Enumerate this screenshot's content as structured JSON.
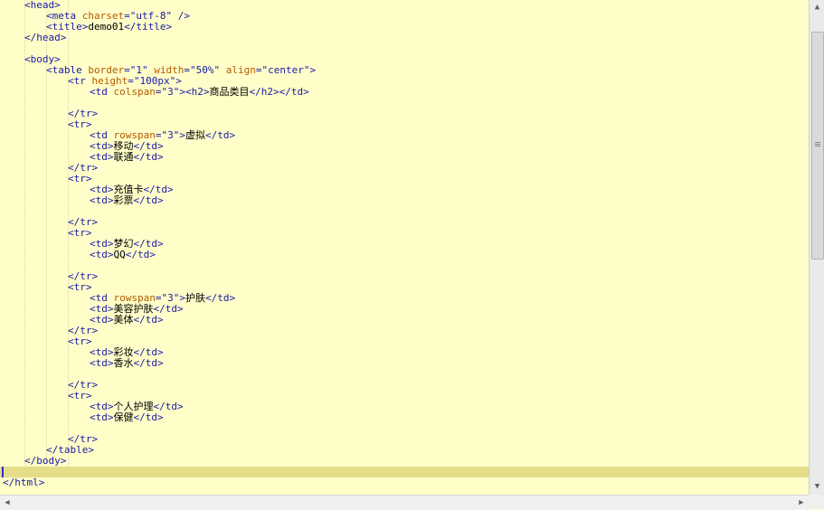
{
  "editor": {
    "lines": [
      [
        {
          "t": "<head>",
          "c": "tag"
        }
      ],
      [
        {
          "t": "<meta ",
          "c": "tag"
        },
        {
          "t": "charset",
          "c": "attr"
        },
        {
          "t": "=\"utf-8\" />",
          "c": "val"
        }
      ],
      [
        {
          "t": "<title>",
          "c": "tag"
        },
        {
          "t": "demo01",
          "c": "text"
        },
        {
          "t": "</title>",
          "c": "tag"
        }
      ],
      [
        {
          "t": "</head>",
          "c": "tag"
        }
      ],
      [],
      [
        {
          "t": "<body>",
          "c": "tag"
        }
      ],
      [
        {
          "t": "<table ",
          "c": "tag"
        },
        {
          "t": "border",
          "c": "attr"
        },
        {
          "t": "=\"1\" ",
          "c": "val"
        },
        {
          "t": "width",
          "c": "attr"
        },
        {
          "t": "=\"50%\" ",
          "c": "val"
        },
        {
          "t": "align",
          "c": "attr"
        },
        {
          "t": "=\"center\">",
          "c": "val"
        }
      ],
      [
        {
          "t": "<tr ",
          "c": "tag"
        },
        {
          "t": "height",
          "c": "attr"
        },
        {
          "t": "=\"100px\">",
          "c": "val"
        }
      ],
      [
        {
          "t": "<td ",
          "c": "tag"
        },
        {
          "t": "colspan",
          "c": "attr"
        },
        {
          "t": "=\"3\">",
          "c": "val"
        },
        {
          "t": "<h2>",
          "c": "tag"
        },
        {
          "t": "商品类目",
          "c": "text"
        },
        {
          "t": "</h2></td>",
          "c": "tag"
        }
      ],
      [],
      [
        {
          "t": "</tr>",
          "c": "tag"
        }
      ],
      [
        {
          "t": "<tr>",
          "c": "tag"
        }
      ],
      [
        {
          "t": "<td ",
          "c": "tag"
        },
        {
          "t": "rowspan",
          "c": "attr"
        },
        {
          "t": "=\"3\">",
          "c": "val"
        },
        {
          "t": "虚拟",
          "c": "text"
        },
        {
          "t": "</td>",
          "c": "tag"
        }
      ],
      [
        {
          "t": "<td>",
          "c": "tag"
        },
        {
          "t": "移动",
          "c": "text"
        },
        {
          "t": "</td>",
          "c": "tag"
        }
      ],
      [
        {
          "t": "<td>",
          "c": "tag"
        },
        {
          "t": "联通",
          "c": "text"
        },
        {
          "t": "</td>",
          "c": "tag"
        }
      ],
      [
        {
          "t": "</tr>",
          "c": "tag"
        }
      ],
      [
        {
          "t": "<tr>",
          "c": "tag"
        }
      ],
      [
        {
          "t": "<td>",
          "c": "tag"
        },
        {
          "t": "充值卡",
          "c": "text"
        },
        {
          "t": "</td>",
          "c": "tag"
        }
      ],
      [
        {
          "t": "<td>",
          "c": "tag"
        },
        {
          "t": "彩票",
          "c": "text"
        },
        {
          "t": "</td>",
          "c": "tag"
        }
      ],
      [],
      [
        {
          "t": "</tr>",
          "c": "tag"
        }
      ],
      [
        {
          "t": "<tr>",
          "c": "tag"
        }
      ],
      [
        {
          "t": "<td>",
          "c": "tag"
        },
        {
          "t": "梦幻",
          "c": "text"
        },
        {
          "t": "</td>",
          "c": "tag"
        }
      ],
      [
        {
          "t": "<td>",
          "c": "tag"
        },
        {
          "t": "QQ",
          "c": "text"
        },
        {
          "t": "</td>",
          "c": "tag"
        }
      ],
      [],
      [
        {
          "t": "</tr>",
          "c": "tag"
        }
      ],
      [
        {
          "t": "<tr>",
          "c": "tag"
        }
      ],
      [
        {
          "t": "<td ",
          "c": "tag"
        },
        {
          "t": "rowspan",
          "c": "attr"
        },
        {
          "t": "=\"3\">",
          "c": "val"
        },
        {
          "t": "护肤",
          "c": "text"
        },
        {
          "t": "</td>",
          "c": "tag"
        }
      ],
      [
        {
          "t": "<td>",
          "c": "tag"
        },
        {
          "t": "美容护肤",
          "c": "text"
        },
        {
          "t": "</td>",
          "c": "tag"
        }
      ],
      [
        {
          "t": "<td>",
          "c": "tag"
        },
        {
          "t": "美体",
          "c": "text"
        },
        {
          "t": "</td>",
          "c": "tag"
        }
      ],
      [
        {
          "t": "</tr>",
          "c": "tag"
        }
      ],
      [
        {
          "t": "<tr>",
          "c": "tag"
        }
      ],
      [
        {
          "t": "<td>",
          "c": "tag"
        },
        {
          "t": "彩妆",
          "c": "text"
        },
        {
          "t": "</td>",
          "c": "tag"
        }
      ],
      [
        {
          "t": "<td>",
          "c": "tag"
        },
        {
          "t": "香水",
          "c": "text"
        },
        {
          "t": "</td>",
          "c": "tag"
        }
      ],
      [],
      [
        {
          "t": "</tr>",
          "c": "tag"
        }
      ],
      [
        {
          "t": "<tr>",
          "c": "tag"
        }
      ],
      [
        {
          "t": "<td>",
          "c": "tag"
        },
        {
          "t": "个人护理",
          "c": "text"
        },
        {
          "t": "</td>",
          "c": "tag"
        }
      ],
      [
        {
          "t": "<td>",
          "c": "tag"
        },
        {
          "t": "保健",
          "c": "text"
        },
        {
          "t": "</td>",
          "c": "tag"
        }
      ],
      [],
      [
        {
          "t": "</tr>",
          "c": "tag"
        }
      ],
      [
        {
          "t": "</table>",
          "c": "tag"
        }
      ],
      [
        {
          "t": "</body>",
          "c": "tag"
        }
      ],
      [],
      [
        {
          "t": "</html>",
          "c": "tag"
        }
      ]
    ],
    "indent_levels": [
      1,
      2,
      2,
      1,
      0,
      1,
      2,
      3,
      4,
      4,
      3,
      3,
      4,
      4,
      4,
      3,
      3,
      4,
      4,
      4,
      3,
      3,
      4,
      4,
      4,
      3,
      3,
      4,
      4,
      4,
      3,
      3,
      4,
      4,
      4,
      3,
      3,
      4,
      4,
      4,
      3,
      2,
      1,
      0,
      0
    ],
    "current_line_index": 43,
    "colors": {
      "background": "#fffdc8",
      "current_line": "#e6dd8a",
      "tag": "#1a1aa6",
      "attribute": "#b35b00",
      "value": "#1a1aa6",
      "text": "#000000"
    }
  },
  "scrollbars": {
    "vertical": {
      "up_icon": "▲",
      "down_icon": "▼"
    },
    "horizontal": {
      "left_icon": "◀",
      "right_icon": "▶"
    }
  }
}
